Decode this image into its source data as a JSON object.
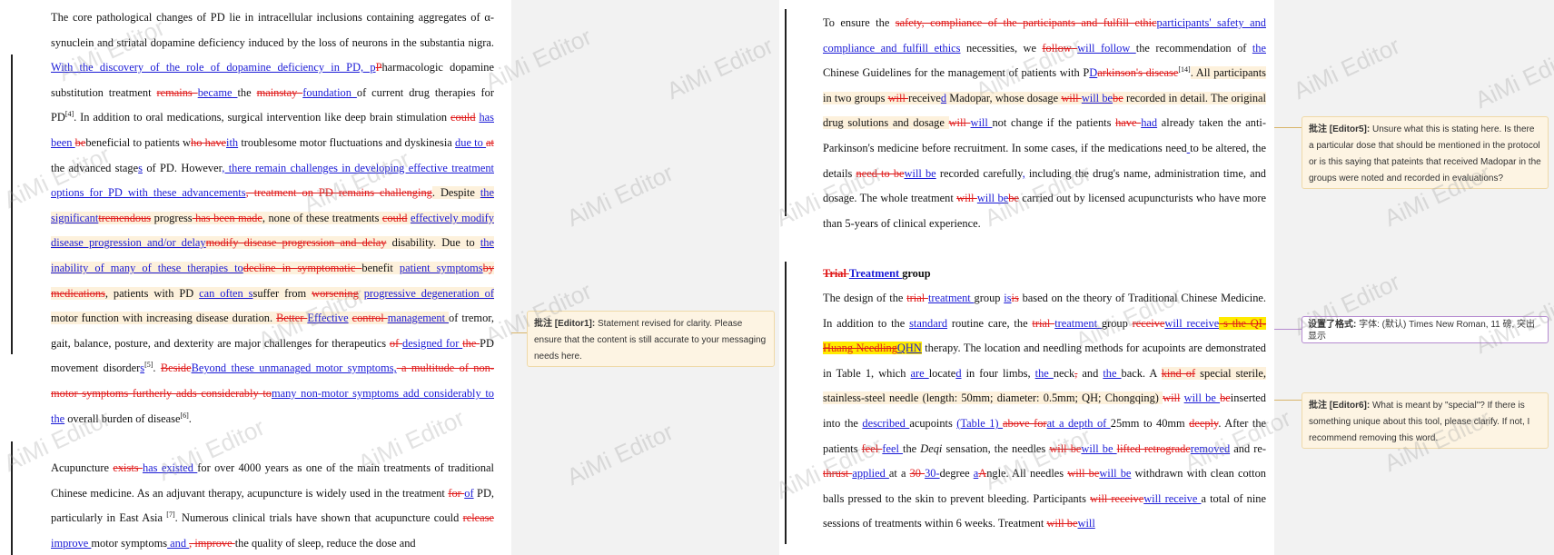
{
  "watermark": "AiMi Editor",
  "left_page": {
    "p1": {
      "a": "The core pathological changes of PD lie in intracellular inclusions containing aggregates of α-synuclein and striatal dopamine deficiency induced by the loss of neurons in the substantia nigra. ",
      "b_ins": "With the discovery of the role of dopamine deficiency in PD, p",
      "b_del": "P",
      "c": "harmacologic dopamine substitution treatment ",
      "d_del": "remains ",
      "d_ins": "became ",
      "e": "the ",
      "f_del": "mainstay ",
      "f_ins": "foundation ",
      "g": "of current drug therapies for PD",
      "g_sup": "[4]",
      "h": ". In addition to oral medications, surgical intervention like deep brain stimulation ",
      "i_del": "could",
      "i_ins": "has been ",
      "i2_del": "be",
      "j": "beneficial to patients w",
      "j_del": "ho have",
      "j_ins": "ith",
      "k": " troublesome motor fluctuations and dyskinesia ",
      "l_ins": "due to ",
      "l_del": "at ",
      "m": "the advanced stage",
      "m_ins": "s",
      "n": " of PD. However",
      "o_ins": ", there remain challenges in developing effective treatment options for PD with these advancements",
      "o_del": ", treatment on PD remains challenging",
      "p": ". Despite ",
      "q_ins": "the significant",
      "q_del": "tremendous",
      "r": " progress",
      "s_del": " has been made",
      "t": ", none of these treatments ",
      "u_del": "could",
      "u_ins": "effectively modify disease progression and/or delay",
      "u2_del": "modify disease progression and delay",
      "v": " disability. Due to ",
      "w_ins": "the inability of many of these therapies to",
      "w_del": "decline in ",
      "w2_del": "symptomatic ",
      "x": "benefit ",
      "y_ins": "patient symptoms",
      "y_del": "by medications",
      "z": ", patients with PD ",
      "z_ins": "can often s",
      "z2": "suffer from ",
      "aa_del": "worsening",
      "aa_ins": "progressive degeneration of ",
      "bb": "motor function with increasing disease duration. ",
      "cc_del": "Better ",
      "cc_ins": "Effective",
      "dd_del": "control ",
      "dd_ins": "management ",
      "ee": "of tremor, gait, balance, posture, and dexterity are major challenges for therapeutics ",
      "ff_del": "of ",
      "ff_ins": "designed for ",
      "gg_del": "the ",
      "hh": "PD movement disorder",
      "hh_ins": "s",
      "hh_sup": "[5]",
      "ii": ". ",
      "jj_del": "Beside",
      "jj_ins": "Beyond these unmanaged motor symptoms,",
      "kk_del": " a multitude of non-motor symptoms furtherly adds considerably to",
      "kk_ins": "many non-motor symptoms add considerably to the",
      "ll": " overall burden of disease",
      "ll_sup": "[6]",
      "mm": "."
    },
    "p2": {
      "a": "Acupuncture ",
      "b_del": "exists ",
      "b_ins": "has existed ",
      "c": "for over 4000 years as one of the main treatments of traditional Chinese medicine. As an adjuvant therapy, acupuncture is widely used in the treatment ",
      "d_del": "for ",
      "d_ins": "of",
      "e": " PD, particularly in East Asia ",
      "e_sup": "[7]",
      "f": ". Numerous clinical trials have shown that acupuncture could ",
      "g_del": "release ",
      "g_ins": "improve ",
      "h": "motor symptoms",
      "i_ins": " and ",
      "i_del": ", improve ",
      "j": "the quality of sleep, reduce the dose and"
    }
  },
  "right_page": {
    "p1": {
      "a": "To ensure the ",
      "b_del": "safety, compliance of the participants and fulfill ethic",
      "b_ins": "participants' safety and compliance and fulfill ethics",
      "c": " necessities, we ",
      "d_del": "follow ",
      "d_ins": "will follow ",
      "e": "the recommendation of ",
      "e_ins": "the",
      "f": " Chinese Guidelines for the management of patients with P",
      "f_ins": "D",
      "f_del": "arkinson's disease",
      "f_sup": "[14]",
      "g": ". All participants in two groups ",
      "h_del": "will ",
      "h2": "receive",
      "h_ins": "d",
      "i": " Madopar, whose dosage ",
      "j_del": "will ",
      "j_ins": "will be",
      "j2_del": "be",
      "k": " recorded in detail. The original drug solutions and dosage ",
      "l_del": "will ",
      "l_ins": "will ",
      "m": "not change if the patients ",
      "n_del": "have ",
      "n_ins": "had",
      "o": " already taken the anti-Parkinson's medicine before recruitment. In some cases, if the medications need",
      "p_ins": " ",
      "p_del": " ",
      "q": "to be altered, the details ",
      "r_del": "need to be",
      "r_ins": "will be",
      "s": " recorded carefully",
      "s_ins": ",",
      "t": " including the drug's name, administration time, and dosage. The whole treatment ",
      "u_del": "will ",
      "u_ins": "will be",
      "u2_del": "be",
      "v": " carried out by licensed acupuncturists who have more than 5-years of clinical experience."
    },
    "heading": {
      "del": "Trial ",
      "ins": "Treatment ",
      "text": "group"
    },
    "p2": {
      "a": "The design of the ",
      "b_del": "trial ",
      "b_ins": "treatment ",
      "c": "group ",
      "c_ins": "is",
      "c_del": "is",
      "d": " based on the theory of Traditional Chinese Medicine. In addition to the ",
      "e_ins": "standard",
      "f": " routine care, the ",
      "g_del": "trial ",
      "g_ins": "treatment ",
      "h": "group ",
      "i_del": "receive",
      "i_ins": "will receive",
      "j_del": " s the QI-Huang Needling",
      "j_ins": "QHN",
      "k": " therapy. The location and needling methods for acupoints are demonstrated in Table 1, which ",
      "l_ins": "are ",
      "m": "locate",
      "m_ins": "d",
      "n": " in four limbs, ",
      "n_ins": "the ",
      "o": "neck",
      "o_del": ",",
      "p": " and ",
      "p_ins": "the ",
      "q": "back. A ",
      "r_del": "kind of",
      "s": " special sterile, stainless-steel needle (length: 50mm; diameter: 0.5mm; QH; Chongqing) ",
      "t_del": "will",
      "t_ins": "will be ",
      "t2_del": "be",
      "u": "inserted into the ",
      "v_ins": "described ",
      "w": "acupoints ",
      "w_ins": "(Table 1) ",
      "x_del": "above for",
      "x_ins": "at a depth of ",
      "y": "25mm to 40mm ",
      "z_del": "deeply",
      "z2": ". After the patients ",
      "aa_del": "feel ",
      "aa_ins": "feel ",
      "bb": "the ",
      "bb_it": "Deqi",
      "cc": " sensation, the needles ",
      "dd_del": "will be",
      "dd_ins": "will be ",
      "ee_del": "lifted retrograde",
      "ee_ins": "removed",
      "ff": " and re-",
      "gg_del": "thrust ",
      "gg_ins": "applied ",
      "hh": "at a ",
      "ii_del": "30 ",
      "ii_ins": "30-",
      "jj": "degree ",
      "jj_ins": "a",
      "jj_del": "A",
      "kk": "ngle. All needles ",
      "ll_del": "will be",
      "ll_ins": "will be",
      "mm": " withdrawn with clean cotton balls pressed to the skin to prevent bleeding. Participants ",
      "nn_del": "will receive",
      "nn_ins": "will receive ",
      "oo": "a total of nine sessions of treatments within 6 weeks. Treatment ",
      "pp_del": "will be",
      "pp_ins": "will"
    }
  },
  "comments": [
    {
      "author": "批注 [Editor1]:",
      "text": " Statement revised for clarity. Please ensure that the content is still accurate to your messaging needs here."
    },
    {
      "author": "批注 [Editor5]:",
      "text": " Unsure what this is stating here. Is there a particular dose that should be mentioned in the protocol or is this saying that pateints that received Madopar in the groups were noted and recorded in evaluations?"
    },
    {
      "author": "设置了格式:",
      "text": " 字体: (默认) Times New Roman, 11 磅, 突出显示"
    },
    {
      "author": "批注 [Editor6]:",
      "text": " What is meant by \"special\"? If there is something unique about this tool, please clarify. If not, I recommend removing this word."
    }
  ]
}
